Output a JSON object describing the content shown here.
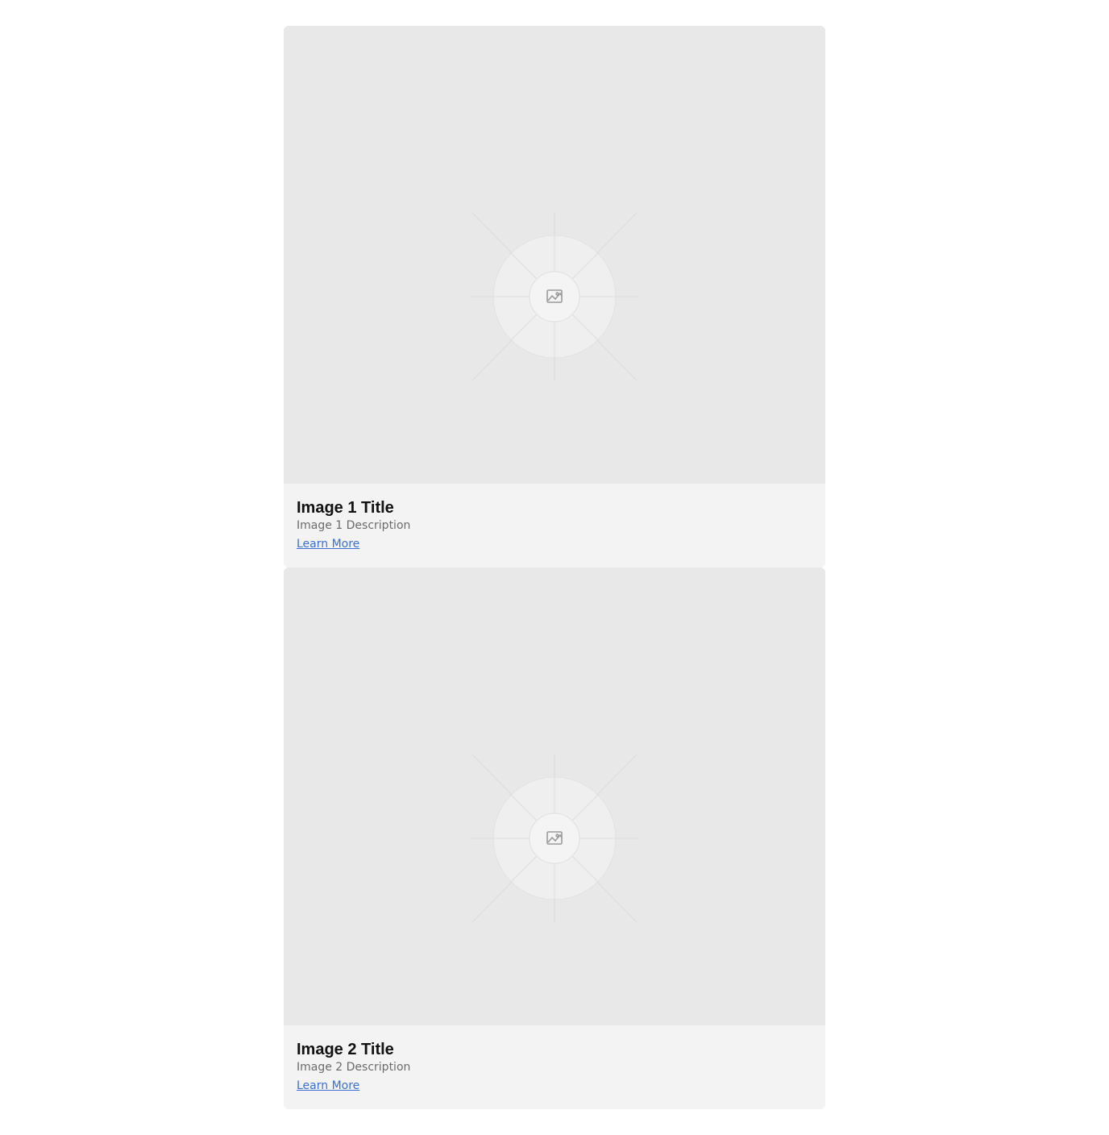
{
  "cards": [
    {
      "title": "Image 1 Title",
      "description": "Image 1 Description",
      "link_label": "Learn More",
      "image_icon": "image-placeholder-icon"
    },
    {
      "title": "Image 2 Title",
      "description": "Image 2 Description",
      "link_label": "Learn More",
      "image_icon": "image-placeholder-icon"
    }
  ],
  "colors": {
    "page_background": "#ffffff",
    "image_background": "#e8e8e8",
    "card_body_background": "#f3f3f3",
    "link": "#3b6fd4",
    "title": "#111111",
    "description": "#6b6b6b"
  }
}
